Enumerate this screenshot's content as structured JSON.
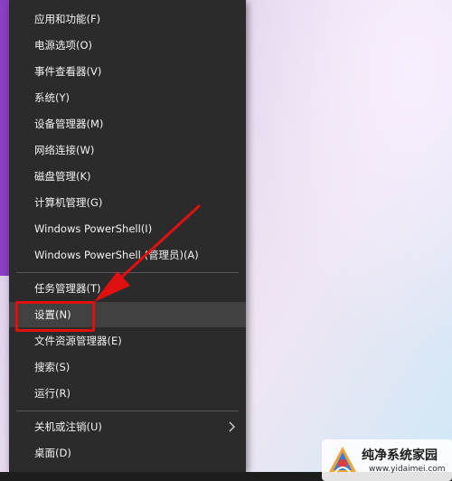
{
  "menu": {
    "items": [
      {
        "label": "应用和功能(F)"
      },
      {
        "label": "电源选项(O)"
      },
      {
        "label": "事件查看器(V)"
      },
      {
        "label": "系统(Y)"
      },
      {
        "label": "设备管理器(M)"
      },
      {
        "label": "网络连接(W)"
      },
      {
        "label": "磁盘管理(K)"
      },
      {
        "label": "计算机管理(G)"
      },
      {
        "label": "Windows PowerShell(I)"
      },
      {
        "label": "Windows PowerShell (管理员)(A)"
      },
      {
        "label": "任务管理器(T)"
      },
      {
        "label": "设置(N)"
      },
      {
        "label": "文件资源管理器(E)"
      },
      {
        "label": "搜索(S)"
      },
      {
        "label": "运行(R)"
      },
      {
        "label": "关机或注销(U)"
      },
      {
        "label": "桌面(D)"
      }
    ],
    "hovered_item": "设置(N)",
    "submenu_icon": "chevron-right-icon"
  },
  "watermark": {
    "title": "纯净系统家园",
    "url": "www.yidaimei.com"
  },
  "colors": {
    "menu_bg": "#2b2b2b",
    "hover_bg": "#414141",
    "highlight": "#e01010",
    "accent_purple": "#8b3fc4"
  }
}
